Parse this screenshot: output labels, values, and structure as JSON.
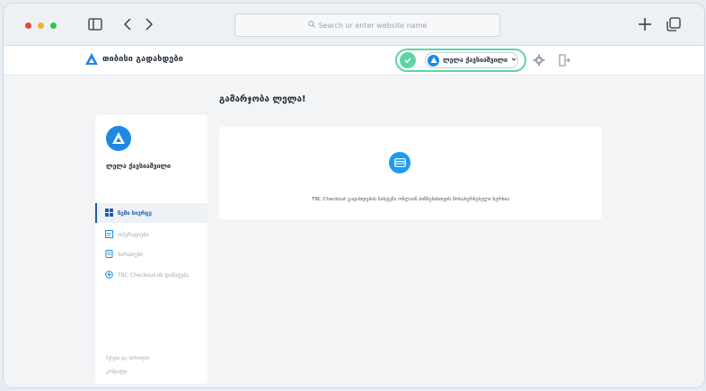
{
  "browser": {
    "search_placeholder": "Search or enter website name"
  },
  "app": {
    "name": "თიბისი გადახდები"
  },
  "user": {
    "name": "ლელა ქავსიაშვილი",
    "pill_label": "ლელა ქავსიაშვილი"
  },
  "sidebar": {
    "name": "ლელა ქავსიაშვილი",
    "items": [
      {
        "label": "ჩემი სივრცე",
        "icon": "grid-icon",
        "active": true
      },
      {
        "label": "ოპერაციები",
        "icon": "receipt-icon",
        "active": false
      },
      {
        "label": "ბარათები",
        "icon": "card-icon",
        "active": false
      },
      {
        "label": "TBC Checkout-ის დამატება",
        "icon": "plus-circle-icon",
        "active": false
      }
    ],
    "footer": [
      "წესები და პირობები",
      "კონტაქტი"
    ]
  },
  "main": {
    "greeting": "გამარჯობა ლელა!",
    "card_text": "TBC Checkout გადახდების სისტემა ონლაინ ბიზნესისთვის მოსახერხებელი ხერხია"
  },
  "colors": {
    "accent": "#1e88e5",
    "highlight": "#5fd3a6"
  }
}
